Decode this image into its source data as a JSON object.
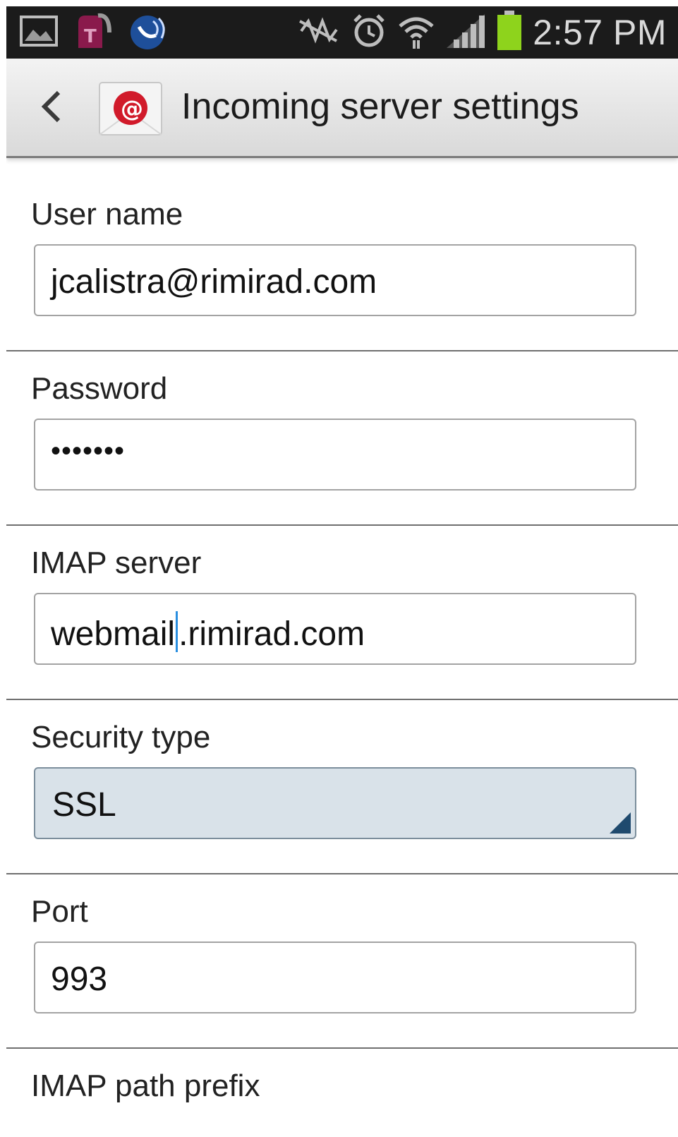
{
  "status_bar": {
    "time": "2:57 PM",
    "icons": [
      "image-icon",
      "tmobile-icon",
      "voicemail-icon",
      "nfc-icon",
      "alarm-icon",
      "wifi-icon",
      "signal-icon",
      "battery-icon"
    ]
  },
  "action_bar": {
    "title": "Incoming server settings",
    "back_icon": "chevron-left-icon",
    "app_icon": "email-at-icon"
  },
  "form": {
    "username": {
      "label": "User name",
      "value": "jcalistra@rimirad.com"
    },
    "password": {
      "label": "Password",
      "value": "•••••••"
    },
    "imap_server": {
      "label": "IMAP server",
      "value_before_cursor": "webmail",
      "value_after_cursor": ".rimirad.com"
    },
    "security_type": {
      "label": "Security type",
      "value": "SSL"
    },
    "port": {
      "label": "Port",
      "value": "993"
    },
    "imap_path_prefix": {
      "label": "IMAP path prefix"
    }
  },
  "colors": {
    "status_bar_bg": "#1b1b1b",
    "battery": "#8ed31c",
    "cursor": "#2a8fe0",
    "select_bg": "#d9e2e9",
    "select_arrow": "#1f4a6e",
    "app_icon_red": "#d11a2a"
  }
}
